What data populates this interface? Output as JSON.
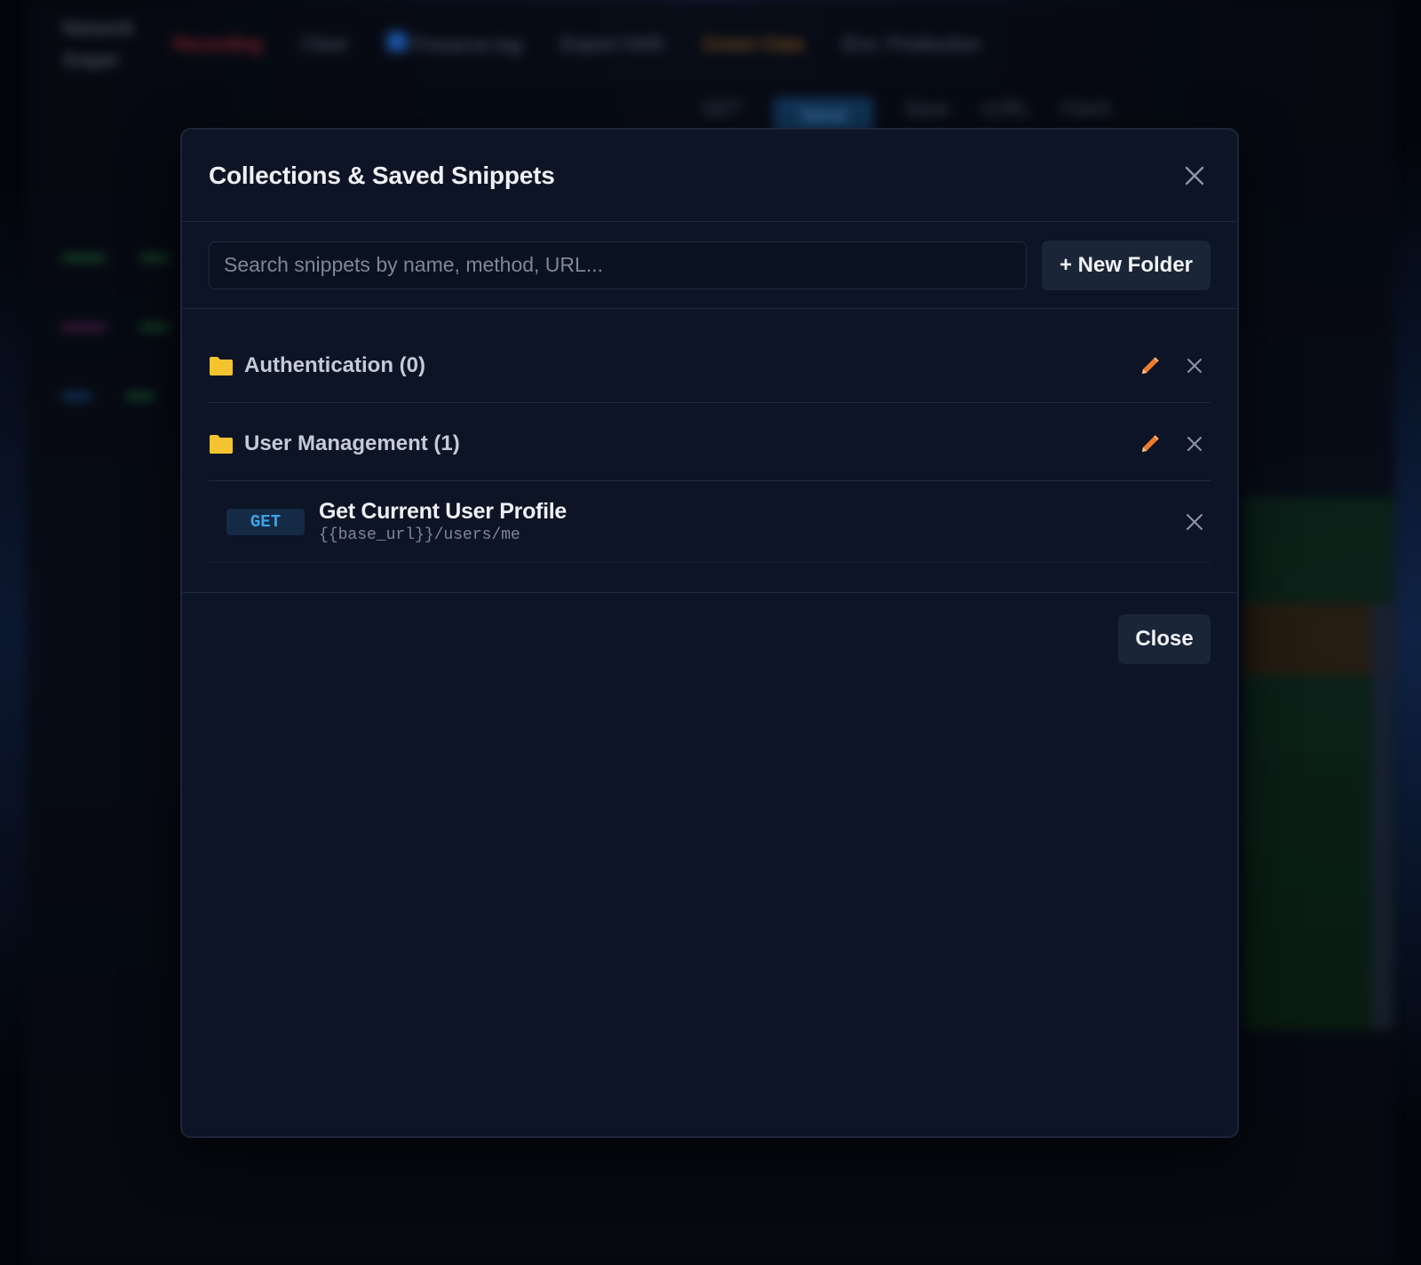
{
  "background": {
    "app_name_line1": "Network",
    "app_name_line2": "Sniper",
    "toolbar": [
      "Recording",
      "Clear",
      "Preserve log",
      "Export HAR",
      "Green Data",
      "Env: Production"
    ],
    "tabs": [
      "GET",
      "Send",
      "Save",
      "cURL",
      "Fetch"
    ]
  },
  "modal": {
    "title": "Collections & Saved Snippets",
    "search_placeholder": "Search snippets by name, method, URL...",
    "search_value": "",
    "new_folder_label": "+ New Folder",
    "close_label": "Close",
    "folders": [
      {
        "name": "Authentication (0)",
        "snippets": []
      },
      {
        "name": "User Management (1)",
        "snippets": [
          {
            "method": "GET",
            "name": "Get Current User Profile",
            "url": "{{base_url}}/users/me"
          }
        ]
      }
    ]
  },
  "colors": {
    "modal_bg": "#0d1425",
    "folder": "#f4c430",
    "edit_icon": "#f07a2c",
    "method_get": "#3ea5e6",
    "button_bg": "#1a2538"
  },
  "icons": {
    "close": "close-icon",
    "folder": "folder-icon",
    "edit": "pencil-icon",
    "delete": "close-icon"
  }
}
